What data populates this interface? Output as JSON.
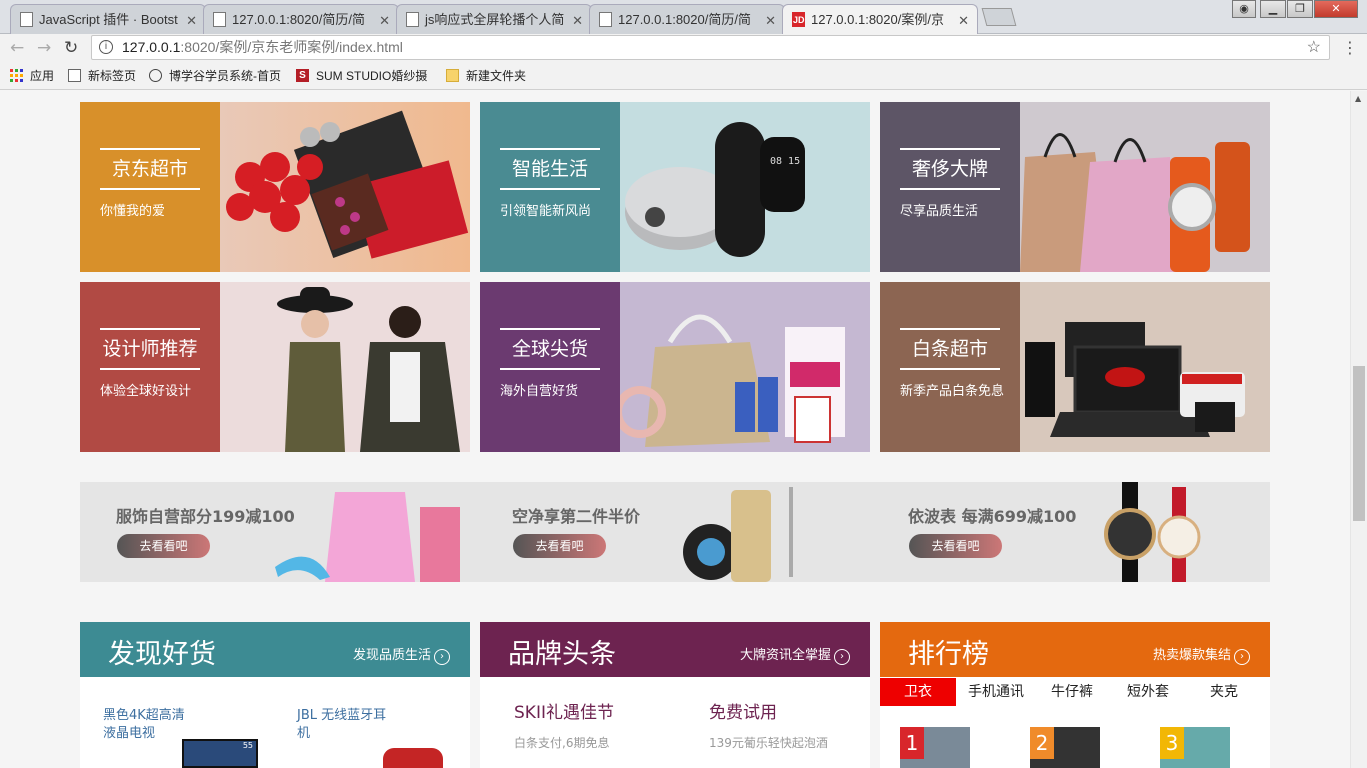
{
  "browser": {
    "tabs": [
      {
        "title": "JavaScript 插件 · Bootst",
        "icon": "page-icon"
      },
      {
        "title": "127.0.0.1:8020/简历/简",
        "icon": "page-icon"
      },
      {
        "title": "js响应式全屏轮播个人简",
        "icon": "page-icon"
      },
      {
        "title": "127.0.0.1:8020/简历/简",
        "icon": "page-icon"
      },
      {
        "title": "127.0.0.1:8020/案例/京",
        "icon": "jd-icon",
        "active": true
      }
    ],
    "jd_favicon_text": "JD",
    "url_host": "127.0.0.1",
    "url_rest": ":8020/案例/京东老师案例/index.html",
    "bookmarks": [
      {
        "label": "应用",
        "icon": "apps-grid-icon"
      },
      {
        "label": "新标签页",
        "icon": "page-icon"
      },
      {
        "label": "博学谷学员系统-首页",
        "icon": "globe-icon"
      },
      {
        "label": "SUM STUDIO婚纱摄",
        "icon": "s-logo-icon"
      },
      {
        "label": "新建文件夹",
        "icon": "folder-icon"
      }
    ]
  },
  "categories": [
    {
      "title": "京东超市",
      "subtitle": "你懂我的爱",
      "color": "#d8902a"
    },
    {
      "title": "智能生活",
      "subtitle": "引领智能新风尚",
      "color": "#4a8b92"
    },
    {
      "title": "奢侈大牌",
      "subtitle": "尽享品质生活",
      "color": "#5d5566"
    },
    {
      "title": "设计师推荐",
      "subtitle": "体验全球好设计",
      "color": "#b14a44"
    },
    {
      "title": "全球尖货",
      "subtitle": "海外自营好货",
      "color": "#6b3a70"
    },
    {
      "title": "白条超市",
      "subtitle": "新季产品白条免息",
      "color": "#8c6552"
    }
  ],
  "promos": [
    {
      "title": "服饰自营部分199减100",
      "button": "去看看吧"
    },
    {
      "title": "空净享第二件半价",
      "button": "去看看吧"
    },
    {
      "title": "依波表 每满699减100",
      "button": "去看看吧"
    }
  ],
  "panels": {
    "discover": {
      "heading": "发现好货",
      "more": "发现品质生活",
      "color": "#3d8b93",
      "items": [
        "黑色4K超高清液晶电视",
        "JBL 无线蓝牙耳机"
      ],
      "tv_badge": "55"
    },
    "brand": {
      "heading": "品牌头条",
      "more": "大牌资讯全掌握",
      "color": "#6d2350",
      "items": [
        {
          "title": "SKII礼遇佳节",
          "sub": "白条支付,6期免息"
        },
        {
          "title": "免费试用",
          "sub": "139元葡乐轻快起泡酒"
        }
      ]
    },
    "ranking": {
      "heading": "排行榜",
      "more": "热卖爆款集结",
      "color": "#e4690f",
      "tabs": [
        "卫衣",
        "手机通讯",
        "牛仔裤",
        "短外套",
        "夹克"
      ],
      "ranks": [
        "1",
        "2",
        "3"
      ]
    }
  },
  "more_glyph": "›"
}
